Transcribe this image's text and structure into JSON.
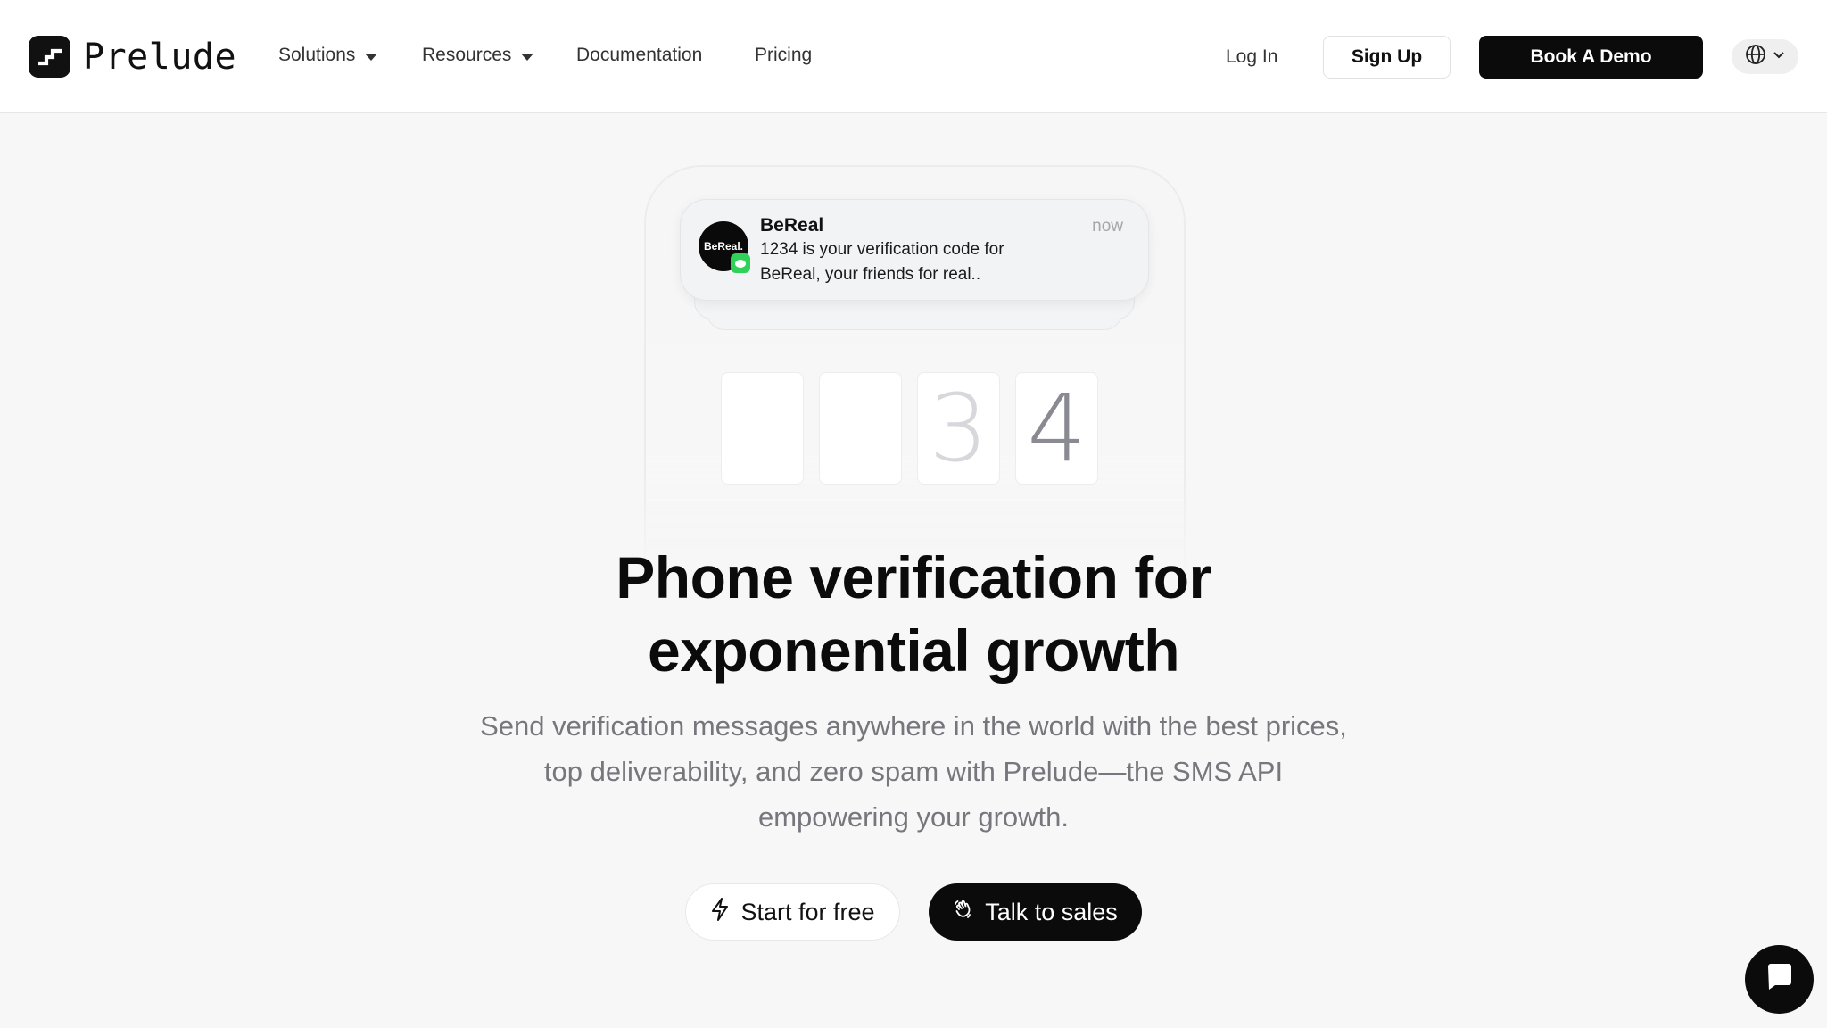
{
  "header": {
    "logo_text": "Prelude",
    "nav": [
      {
        "label": "Solutions",
        "has_dropdown": true
      },
      {
        "label": "Resources",
        "has_dropdown": true
      },
      {
        "label": "Documentation",
        "has_dropdown": false
      },
      {
        "label": "Pricing",
        "has_dropdown": false
      }
    ],
    "login_label": "Log In",
    "signup_label": "Sign Up",
    "demo_label": "Book A Demo",
    "language_icon": "globe-icon"
  },
  "notification": {
    "app_icon_text": "BeReal.",
    "app_name": "BeReal",
    "time": "now",
    "message": "1234 is your verification code for BeReal, your friends for real.."
  },
  "code_digits": [
    "",
    "",
    "3",
    "4"
  ],
  "hero": {
    "title_line1": "Phone verification for",
    "title_line2": "exponential growth",
    "subtitle": "Send verification messages anywhere in the world with the best prices, top deliverability, and zero spam with Prelude—the SMS API empowering your growth."
  },
  "cta": {
    "start_label": "Start for free",
    "start_icon": "lightning-icon",
    "sales_label": "Talk to sales",
    "sales_icon": "waving-hand-icon"
  },
  "chat_widget_icon": "chat-bubble-icon",
  "colors": {
    "background": "#f7f7f7",
    "primary": "#0b0b0b",
    "muted_text": "#76767c",
    "imessage_green": "#2fd158"
  }
}
